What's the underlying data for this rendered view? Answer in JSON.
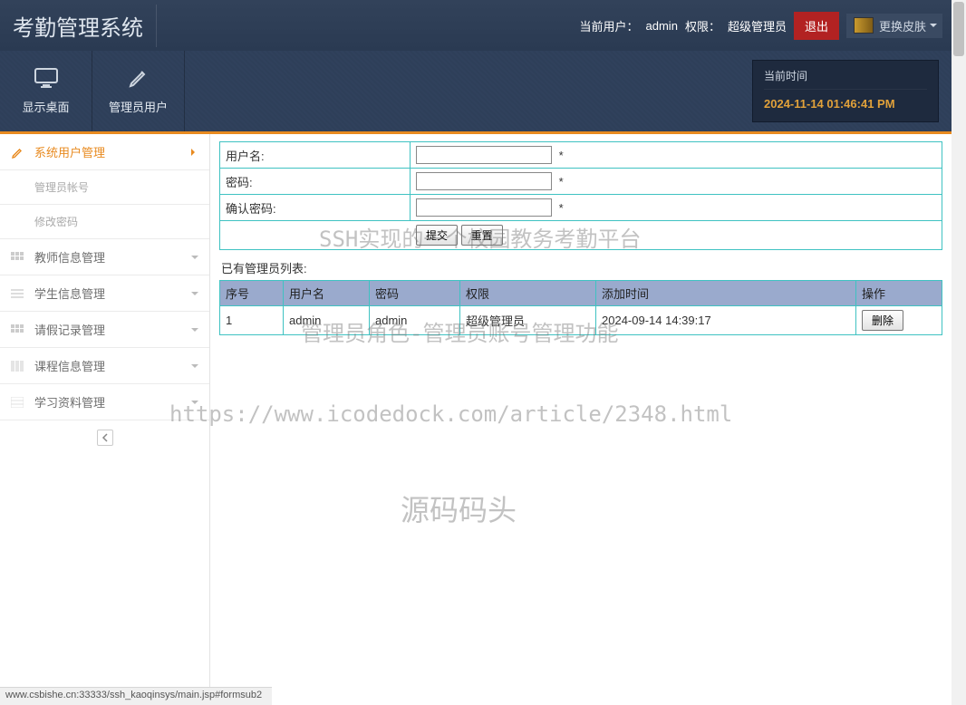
{
  "header": {
    "title": "考勤管理系统",
    "current_user_label": "当前用户：",
    "current_user": "admin",
    "perm_label": "权限：",
    "perm_value": "超级管理员",
    "logout_label": "退出",
    "skin_label": "更换皮肤"
  },
  "ribbon": {
    "items": [
      {
        "label": "显示桌面"
      },
      {
        "label": "管理员用户"
      }
    ],
    "time_panel": {
      "title": "当前时间",
      "value": "2024-11-14 01:46:41 PM"
    }
  },
  "sidebar": {
    "items": [
      {
        "label": "系统用户管理",
        "active": true
      },
      {
        "label": "教师信息管理"
      },
      {
        "label": "学生信息管理"
      },
      {
        "label": "请假记录管理"
      },
      {
        "label": "课程信息管理"
      },
      {
        "label": "学习资料管理"
      }
    ],
    "subitems": [
      {
        "label": "管理员帐号"
      },
      {
        "label": "修改密码"
      }
    ]
  },
  "form": {
    "username_label": "用户名:",
    "password_label": "密码:",
    "confirm_label": "确认密码:",
    "star": "*",
    "submit_label": "提交",
    "reset_label": "重置"
  },
  "list": {
    "title": "已有管理员列表:",
    "headers": {
      "index": "序号",
      "username": "用户名",
      "password": "密码",
      "perm": "权限",
      "created": "添加时间",
      "action": "操作"
    },
    "rows": [
      {
        "index": "1",
        "username": "admin",
        "password": "admin",
        "perm": "超级管理员",
        "created": "2024-09-14 14:39:17",
        "action_label": "删除"
      }
    ]
  },
  "watermarks": {
    "w1": "SSH实现的一个校园教务考勤平台",
    "w2": "管理员角色-管理员账号管理功能",
    "w3": "https://www.icodedock.com/article/2348.html",
    "w4": "源码码头"
  },
  "statusbar": {
    "text": "www.csbishe.cn:33333/ssh_kaoqinsys/main.jsp#formsub2"
  }
}
